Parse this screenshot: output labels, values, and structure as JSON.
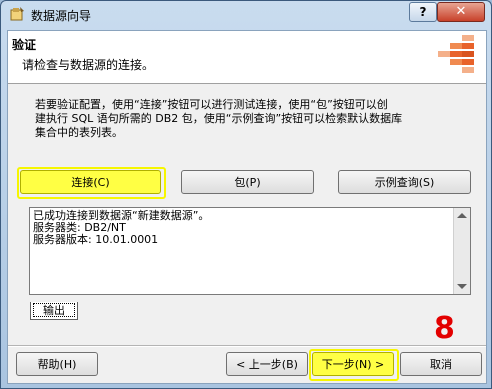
{
  "window": {
    "title": "数据源向导",
    "help_label": "?",
    "close_label": "✕"
  },
  "header": {
    "title": "验证",
    "subtitle": "请检查与数据源的连接。"
  },
  "description": [
    "若要验证配置，使用“连接”按钮可以进行测试连接，使用“包”按钮可以创",
    "建执行 SQL 语句所需的 DB2 包，使用“示例查询”按钮可以检索默认数据库",
    "集合中的表列表。"
  ],
  "buttons": {
    "connect": "连接(C)",
    "package": "包(P)",
    "sample_query": "示例查询(S)"
  },
  "output": {
    "lines": [
      "已成功连接到数据源“新建数据源”。",
      "服务器类: DB2/NT",
      "服务器版本: 10.01.0001"
    ],
    "tab_label": "输出"
  },
  "step_badge": "8",
  "footer": {
    "help": "帮助(H)",
    "back": "< 上一步(B)",
    "next": "下一步(N) >",
    "cancel": "取消"
  },
  "colors": {
    "highlight": "#ffff44",
    "step_badge": "#e30000",
    "logo_orange": "#e8622a"
  }
}
